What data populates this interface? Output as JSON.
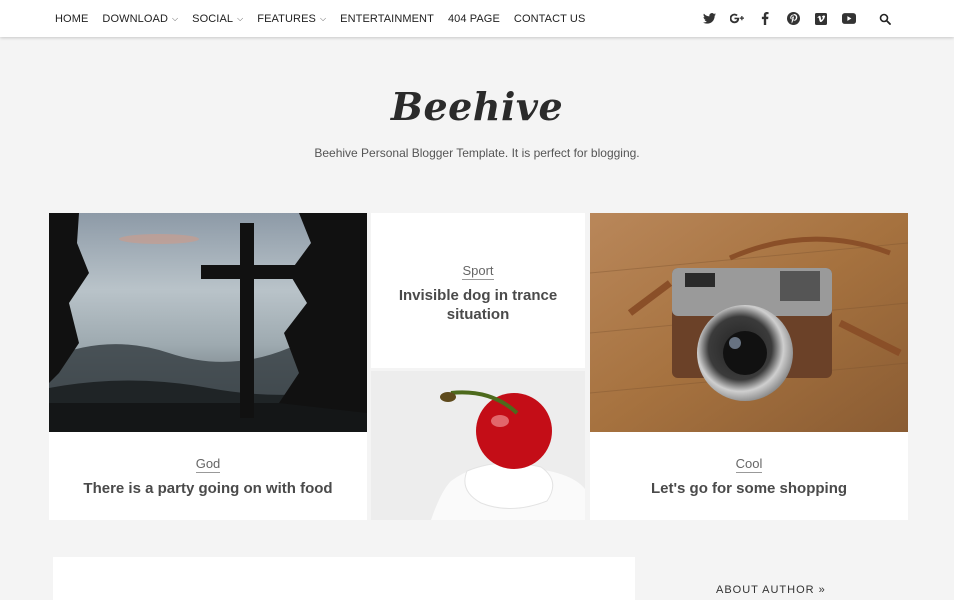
{
  "nav": {
    "items": [
      {
        "label": "HOME",
        "dropdown": false
      },
      {
        "label": "DOWNLOAD",
        "dropdown": true
      },
      {
        "label": "SOCIAL",
        "dropdown": true
      },
      {
        "label": "FEATURES",
        "dropdown": true
      },
      {
        "label": "ENTERTAINMENT",
        "dropdown": false
      },
      {
        "label": "404 PAGE",
        "dropdown": false
      },
      {
        "label": "CONTACT US",
        "dropdown": false
      }
    ],
    "social_icons": [
      "twitter-icon",
      "google-plus-icon",
      "facebook-icon",
      "pinterest-icon",
      "vimeo-icon",
      "youtube-icon",
      "search-icon"
    ]
  },
  "header": {
    "title": "Beehive",
    "tagline": "Beehive Personal Blogger Template. It is perfect for blogging."
  },
  "posts": [
    {
      "category": "God",
      "title": "There is a party going on with food"
    },
    {
      "category": "Sport",
      "title": "Invisible dog in trance situation"
    },
    {
      "category": "Cool",
      "title": "Let's go for some shopping"
    }
  ],
  "sidebar": {
    "about_author": "ABOUT AUTHOR »"
  },
  "colors": {
    "background": "#f4f4f4",
    "card": "#ffffff",
    "title_text": "#4a4a4a"
  }
}
